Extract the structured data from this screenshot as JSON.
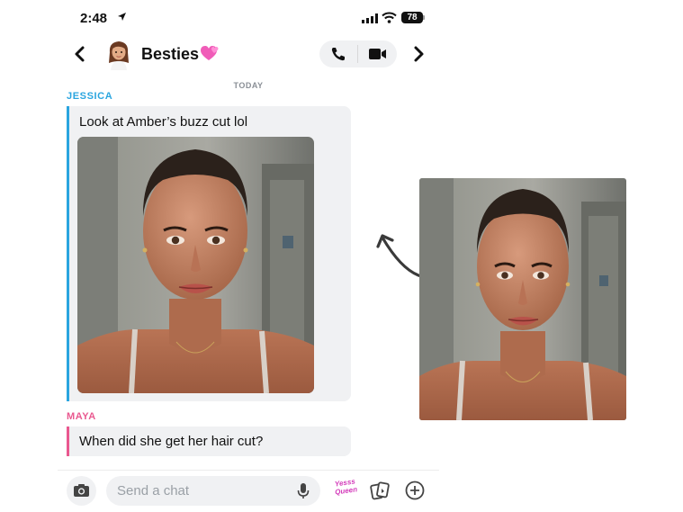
{
  "status_bar": {
    "time": "2:48",
    "battery": "78"
  },
  "header": {
    "title": "Besties"
  },
  "chat": {
    "day_label": "TODAY",
    "messages": [
      {
        "sender": "JESSICA",
        "text": "Look at Amber’s buzz cut lol",
        "color": "#2aa5df"
      },
      {
        "sender": "MAYA",
        "text": "When did she get her hair cut?",
        "color": "#e9588f"
      }
    ]
  },
  "input": {
    "placeholder": "Send a chat"
  },
  "sticker": {
    "line1": "Yesss",
    "line2": "Queen"
  },
  "icons": [
    "location-arrow-icon",
    "signal-icon",
    "wifi-icon",
    "battery-icon",
    "back-chevron-icon",
    "avatar",
    "heart-icon",
    "phone-icon",
    "video-icon",
    "forward-chevron-icon",
    "camera-icon",
    "mic-icon",
    "cards-icon",
    "plus-icon",
    "curved-arrow"
  ]
}
